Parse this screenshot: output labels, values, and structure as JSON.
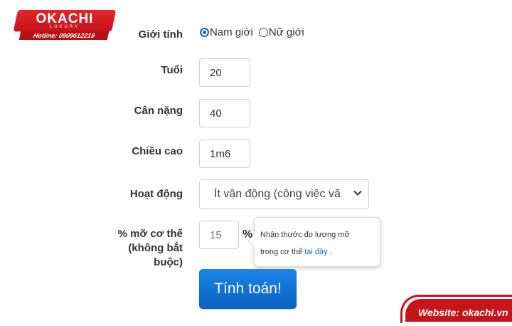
{
  "logo": {
    "brand": "OKACHI",
    "sub": "LUXURY",
    "hotline": "Hotline: 0909612219"
  },
  "form": {
    "gender": {
      "label": "Giới tính",
      "options": [
        {
          "label": "Nam giới",
          "checked": true
        },
        {
          "label": "Nữ giới",
          "checked": false
        }
      ]
    },
    "age": {
      "label": "Tuổi",
      "value": "20"
    },
    "weight": {
      "label": "Cân nặng",
      "value": "40"
    },
    "height": {
      "label": "Chiều cao",
      "value": "1m6"
    },
    "activity": {
      "label": "Hoạt động",
      "value": "Ít vận động (công việc vă"
    },
    "body_fat": {
      "label_line1": "% mỡ cơ thể",
      "label_line2": "(không bắt",
      "label_line3": "buộc)",
      "placeholder": "15",
      "unit": "%"
    },
    "tooltip": {
      "line1": "Nhận thước đo lượng mỡ",
      "line2_prefix": "trong cơ thể ",
      "link": "tại đây",
      "line2_suffix": " ."
    },
    "submit_label": "Tính toán!"
  },
  "footer": {
    "website": "Website: okachi.vn"
  },
  "colors": {
    "brand_red": "#c8141b",
    "button_blue": "#0a5fc3",
    "radio_blue": "#0b63c9"
  }
}
